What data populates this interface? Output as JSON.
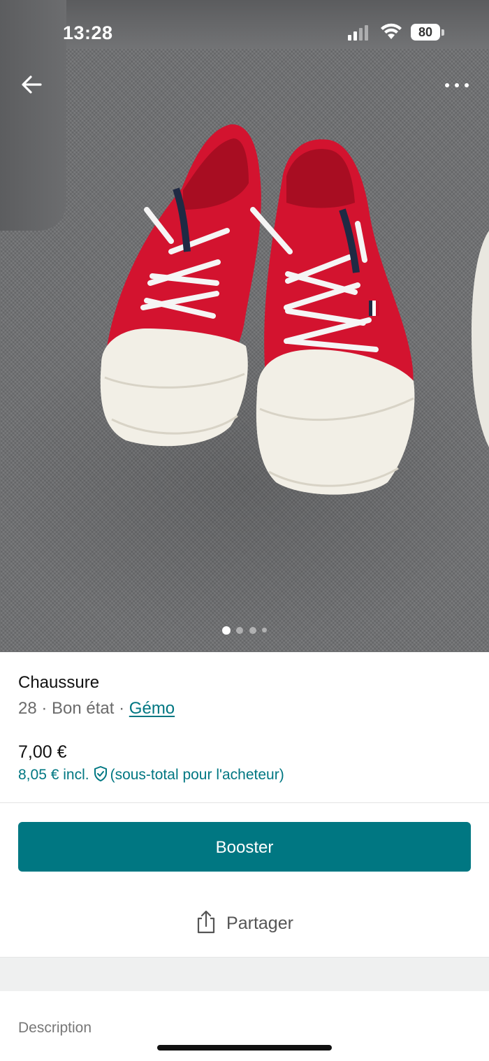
{
  "status_bar": {
    "time": "13:28",
    "battery": "80"
  },
  "photo": {
    "pager": {
      "count": 4,
      "active": 0
    }
  },
  "item": {
    "title": "Chaussure",
    "size": "28",
    "separator": "·",
    "condition": "Bon état",
    "brand": "Gémo",
    "price": "7,00 €",
    "price_incl": "8,05 € incl.",
    "buyer_note": "(sous-total pour l'acheteur)"
  },
  "actions": {
    "booster_label": "Booster",
    "share_label": "Partager"
  },
  "description": {
    "label": "Description"
  },
  "colors": {
    "accent": "#007782",
    "shoe_red": "#d3132f"
  },
  "icons": [
    "back-arrow-icon",
    "more-icon",
    "shield-check-icon",
    "share-icon",
    "signal-icon",
    "wifi-icon",
    "battery-icon"
  ]
}
